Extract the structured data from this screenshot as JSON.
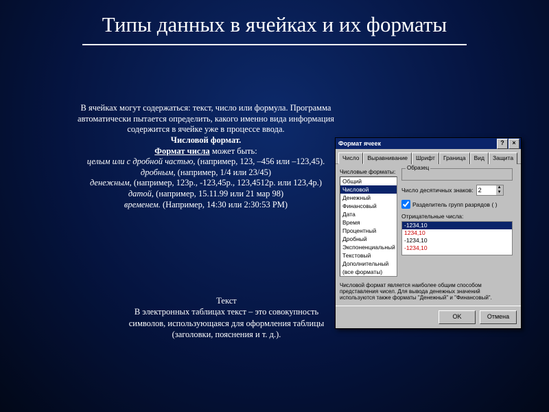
{
  "title": "Типы данных в ячейках и их форматы",
  "para1": "В ячейках могут содержаться: текст, число или формула. Программа автоматически пытается определить, какого именно вида информация содержится в ячейке уже в процессе ввода.",
  "numFmtHeader": "Числовой формат.",
  "fmtNumLead": "Формат числа",
  "fmtNumTail": " может быть:",
  "line_int": "целым или с дробной частью,",
  "line_int_ex": " (например, 123, –456 или –123,45).",
  "line_frac": "дробным,",
  "line_frac_ex": " (например, 1/4 или 23/45)",
  "line_money": "денежным,",
  "line_money_ex": " (например, 123р., -123,45р., 123,4512р. или 123,4р.)",
  "line_date": "датой,",
  "line_date_ex": " (например, 15.11.99 или 21 мар 98)",
  "line_time": "временем.",
  "line_time_ex": " (Например, 14:30 или 2:30:53 PM)",
  "textHeader": "Текст",
  "textBody": "В электронных таблицах текст – это совокупность символов, использующаяся для оформления таблицы  (заголовки, пояснения и т. д.).",
  "dialog": {
    "title": "Формат ячеек",
    "tabs": [
      "Число",
      "Выравнивание",
      "Шрифт",
      "Граница",
      "Вид",
      "Защита"
    ],
    "formatsLabel": "Числовые форматы:",
    "formats": [
      "Общий",
      "Числовой",
      "Денежный",
      "Финансовый",
      "Дата",
      "Время",
      "Процентный",
      "Дробный",
      "Экспоненциальный",
      "Текстовый",
      "Дополнительный",
      "(все форматы)"
    ],
    "selectedFormatIndex": 1,
    "sampleLabel": "Образец",
    "decimalsLabel": "Число десятичных знаков:",
    "decimalsValue": "2",
    "sepLabel": "Разделитель групп разрядов ( )",
    "negLabel": "Отрицательные числа:",
    "negatives": [
      "-1234,10",
      "1234,10",
      "-1234,10",
      "-1234,10"
    ],
    "descText": "Числовой формат является наиболее общим способом представления чисел. Для вывода денежных значений используются также форматы \"Денежный\" и \"Финансовый\".",
    "ok": "OK",
    "cancel": "Отмена"
  }
}
